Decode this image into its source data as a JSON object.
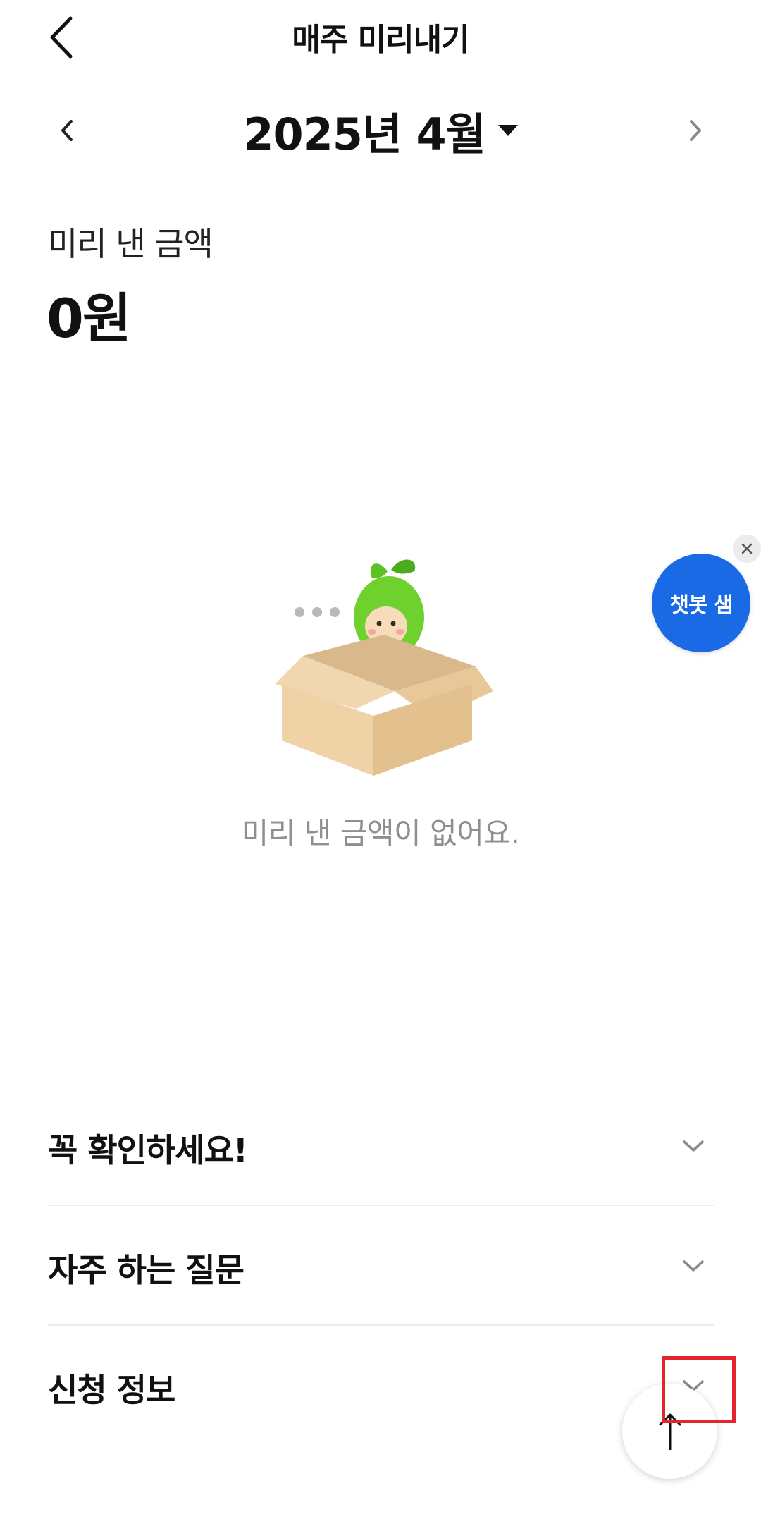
{
  "header": {
    "title": "매주 미리내기"
  },
  "month_selector": {
    "label": "2025년 4월"
  },
  "summary": {
    "label": "미리 낸 금액",
    "amount": "0원"
  },
  "empty_state": {
    "message": "미리 낸 금액이 없어요."
  },
  "chatbot": {
    "label": "챗봇 샘"
  },
  "accordion": {
    "items": [
      {
        "label": "꼭 확인하세요!"
      },
      {
        "label": "자주 하는 질문"
      },
      {
        "label": "신청 정보"
      }
    ]
  },
  "colors": {
    "accent": "#1a6ae6",
    "highlight": "#e3262b",
    "muted_text": "#8f8f8f"
  }
}
